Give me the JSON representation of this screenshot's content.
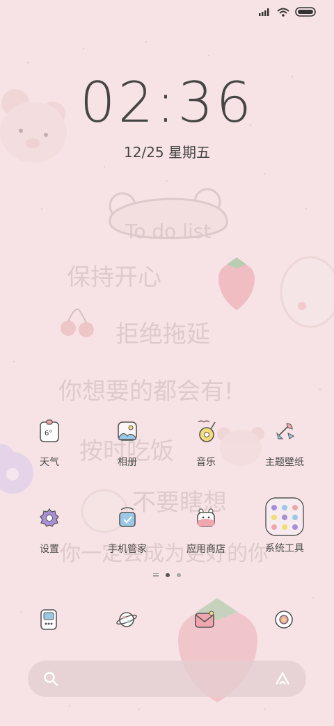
{
  "status": {
    "icons": [
      "signal-icon",
      "wifi-icon",
      "battery-icon"
    ]
  },
  "clock": {
    "time": "02:36",
    "date": "12/25 星期五"
  },
  "wallpaper": {
    "decoration_texts": [
      "To do list",
      "保持开心",
      "拒绝拖延",
      "你想要的都会有!",
      "按时吃饭",
      "不要瞎想",
      "你一定会成为更好的你"
    ]
  },
  "apps": [
    {
      "label": "天气",
      "icon": "weather-icon",
      "badge": "6°"
    },
    {
      "label": "相册",
      "icon": "gallery-icon"
    },
    {
      "label": "音乐",
      "icon": "music-icon"
    },
    {
      "label": "主题壁纸",
      "icon": "theme-icon"
    },
    {
      "label": "设置",
      "icon": "settings-icon"
    },
    {
      "label": "手机管家",
      "icon": "security-icon"
    },
    {
      "label": "应用商店",
      "icon": "app-store-icon"
    },
    {
      "label": "系统工具",
      "icon": "system-tools-folder-icon"
    }
  ],
  "dock": [
    "phone-icon",
    "browser-icon",
    "messages-icon",
    "camera-icon"
  ],
  "pager": {
    "pages": 2,
    "active": 0
  },
  "colors": {
    "background": "#f7e3e5",
    "text": "#454545",
    "accent_pink": "#f0a6ae",
    "accent_yellow": "#f5dc7a",
    "accent_purple": "#a98fd6",
    "accent_blue": "#9cc8e8"
  }
}
